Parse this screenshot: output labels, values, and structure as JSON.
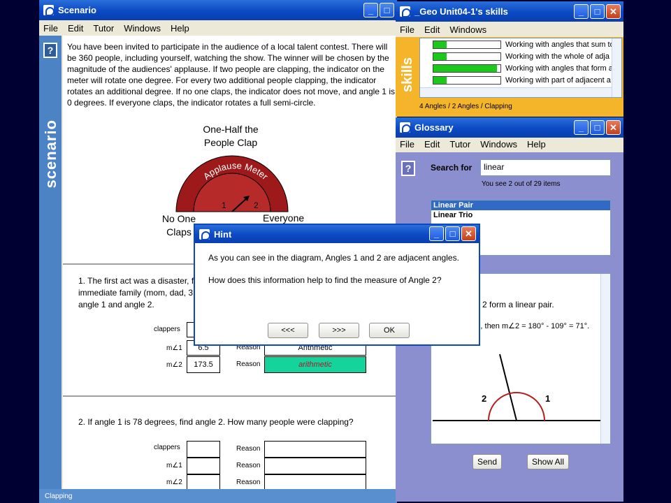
{
  "scenario": {
    "title": "Scenario",
    "menu": [
      "File",
      "Edit",
      "Tutor",
      "Windows",
      "Help"
    ],
    "side_label": "scenario",
    "help_glyph": "?",
    "intro": "You have been invited to participate in the audience of a local talent contest. There will be 360 people, including yourself, watching the show. The winner will be chosen by the magnitude of the audiences' applause. If two people are clapping, the indicator on the meter will rotate one degree. For every two additional people clapping, the indicator rotates an additional degree. If no one claps, the indicator does not move, and angle 1 is 0 degrees. If everyone claps, the indicator rotates a full semi-circle.",
    "meter": {
      "top_label_1": "One-Half the",
      "top_label_2": "People Clap",
      "arc_text": "Applause Meter",
      "left_label_1": "No One",
      "left_label_2": "Claps",
      "right_label": "Everyone",
      "angle1": "1",
      "angle2": "2"
    },
    "q1": {
      "text_1": "1. The first act was a disaster, f",
      "text_2": "immediate family (mom, dad, 3",
      "text_3": "angle 1 and angle 2.",
      "clappers_label": "clappers",
      "m1_label": "m∠1",
      "m2_label": "m∠2",
      "m1_value": "6.5",
      "m2_value": "173.5",
      "reason_label": "Reason",
      "reason1": "Arithmetic",
      "reason2": "arithmetic"
    },
    "q2": {
      "text": "2. If angle 1 is 78 degrees, find angle 2. How many people were clapping?",
      "clappers_label": "clappers",
      "m1_label": "m∠1",
      "m2_label": "m∠2",
      "reason_label": "Reason"
    },
    "status": "Clapping"
  },
  "skills": {
    "title": "_Geo Unit04-1's skills",
    "menu": [
      "File",
      "Edit",
      "Windows"
    ],
    "side_label": "skills",
    "items": [
      {
        "label": "Working with angles that sum to",
        "progress": 0.2
      },
      {
        "label": "Working with the whole of adja",
        "progress": 0.2
      },
      {
        "label": "Working with angles that form a",
        "progress": 0.95
      },
      {
        "label": "Working with part of adjacent a",
        "progress": 0.2
      }
    ],
    "status": "4 Angles / 2 Angles / Clapping"
  },
  "glossary": {
    "title": "Glossary",
    "menu": [
      "File",
      "Edit",
      "Tutor",
      "Windows",
      "Help"
    ],
    "help_glyph": "?",
    "search_label": "Search for",
    "search_value": "linear",
    "count_text": "You see 2 out of 29 items",
    "results": [
      "Linear Pair",
      "Linear Trio"
    ],
    "def_text": "2 form a linear pair.",
    "example_text": "°, then m∠2 = 180° - 109° = 71°.",
    "angle1": "1",
    "angle2": "2",
    "send_label": "Send",
    "show_all_label": "Show All"
  },
  "hint": {
    "title": "Hint",
    "line1": "As you can see in the diagram, Angles 1 and 2 are adjacent angles.",
    "line2": "How does this information help to find the measure of Angle 2?",
    "prev_label": "<<<",
    "next_label": ">>>",
    "ok_label": "OK"
  },
  "colors": {
    "title_blue": "#0b49c4",
    "skills_bg": "#f5b52a",
    "meter_red": "#9e1a1a",
    "correct_green": "#14d49c",
    "progress_green": "#1bc81b",
    "selection_blue": "#316ac5"
  }
}
